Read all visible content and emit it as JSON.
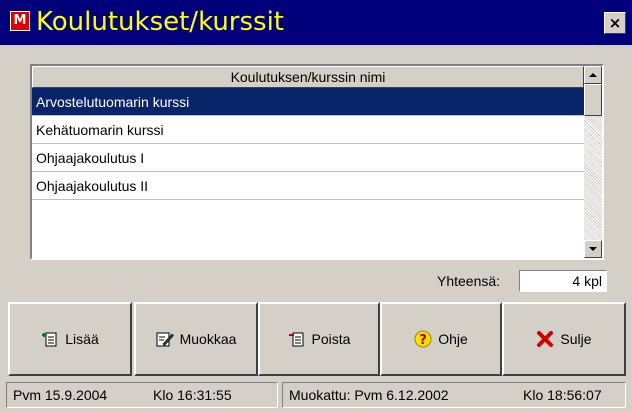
{
  "window": {
    "title": "Koulutukset/kurssit",
    "app_icon_letter": "M",
    "close_glyph": "×"
  },
  "list": {
    "column_header": "Koulutuksen/kurssin nimi",
    "rows": [
      "Arvostelutuomarin kurssi",
      "Kehätuomarin kurssi",
      "Ohjaajakoulutus I",
      "Ohjaajakoulutus II"
    ],
    "selected_index": 0
  },
  "total": {
    "label": "Yhteensä:",
    "value": "4 kpl"
  },
  "buttons": {
    "add": "Lisää",
    "edit": "Muokkaa",
    "delete": "Poista",
    "help": "Ohje",
    "close": "Sulje"
  },
  "status": {
    "date": "Pvm 15.9.2004",
    "time": "Klo 16:31:55",
    "modified": "Muokattu: Pvm 6.12.2002",
    "modified_time": "Klo 18:56:07"
  },
  "colors": {
    "title_bar": "#00007b",
    "title_text": "#ffff00",
    "selection": "#0a246a",
    "face": "#d4d0c8"
  }
}
